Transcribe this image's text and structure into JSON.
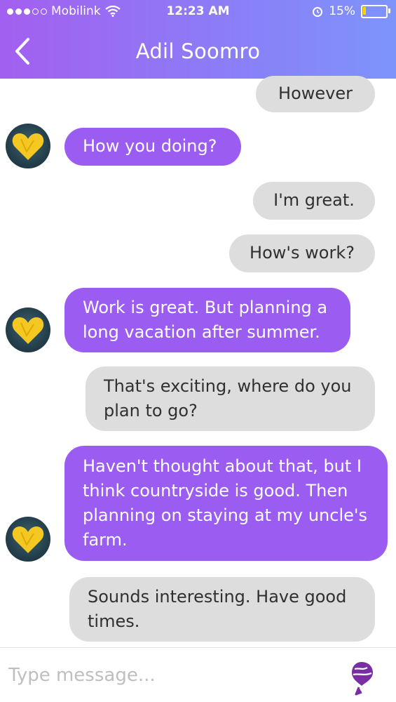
{
  "status_bar": {
    "carrier": "Mobilink",
    "time": "12:23 AM",
    "battery_percent": "15%",
    "battery_level": 0.15,
    "battery_fill_color": "#ffd400"
  },
  "nav": {
    "back_icon": "chevron-left-icon",
    "title": "Adil Soomro"
  },
  "messages": [
    {
      "sender": "me",
      "text": "However"
    },
    {
      "sender": "contact",
      "text": "How you doing?"
    },
    {
      "sender": "me",
      "text": "I'm great."
    },
    {
      "sender": "me",
      "text": "How's work?"
    },
    {
      "sender": "contact",
      "lines": [
        "Work is great. But planning a",
        "long vacation after summer."
      ]
    },
    {
      "sender": "me",
      "lines": [
        "That's exciting, where do you",
        "plan to go?"
      ]
    },
    {
      "sender": "contact",
      "lines": [
        "Haven't thought about that, but I",
        "think countryside is good. Then",
        "planning on staying at my uncle's",
        "farm."
      ]
    },
    {
      "sender": "me",
      "lines": [
        "Sounds interesting. Have good",
        "times."
      ]
    }
  ],
  "composer": {
    "placeholder": "Type message...",
    "send_icon": "balloon-send-icon"
  },
  "colors": {
    "header_gradient_start": "#a35ff0",
    "header_gradient_end": "#7d94fb",
    "incoming_bubble": "#9b5cf2",
    "outgoing_bubble": "#dddddd",
    "send_icon": "#7a2ea3"
  }
}
